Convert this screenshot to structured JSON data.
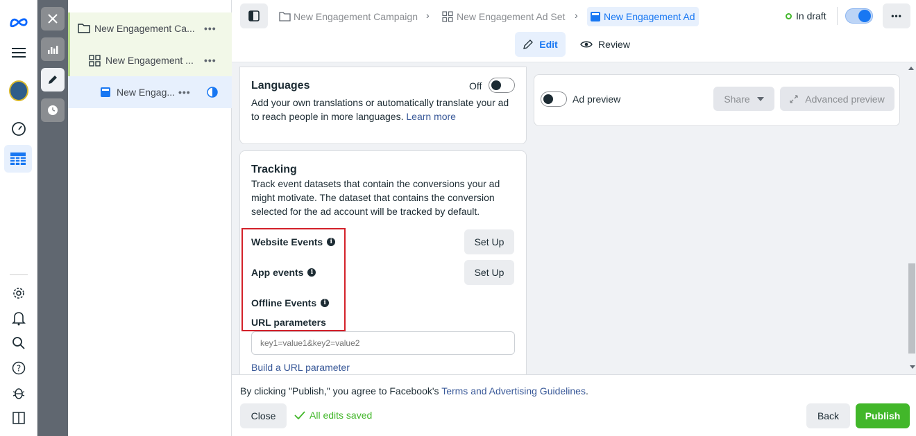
{
  "global_nav": {
    "icons": [
      "meta-logo-icon",
      "menu-icon",
      "account-avatar-icon",
      "dashboard-gauge-icon",
      "ads-manager-table-icon",
      "settings-gear-icon",
      "notifications-bell-icon",
      "search-icon",
      "help-icon",
      "bug-report-icon",
      "panel-toggle-icon"
    ]
  },
  "tree": {
    "campaign": "New Engagement Ca...",
    "ad_set": "New Engagement ...",
    "ad": "New Engag..."
  },
  "header": {
    "breadcrumb_campaign": "New Engagement Campaign",
    "breadcrumb_ad_set": "New Engagement Ad Set",
    "breadcrumb_ad": "New Engagement Ad",
    "status": "In draft",
    "edit_tab": "Edit",
    "review_tab": "Review",
    "accent_color": "#1877f2",
    "status_color": "#42b72a"
  },
  "languages": {
    "title": "Languages",
    "toggle_label": "Off",
    "description": "Add your own translations or automatically translate your ad to reach people in more languages.",
    "learn_more": "Learn more"
  },
  "tracking": {
    "title": "Tracking",
    "description": "Track event datasets that contain the conversions your ad might motivate. The dataset that contains the conversion selected for the ad account will be tracked by default.",
    "website_events": "Website Events",
    "app_events": "App events",
    "offline_events": "Offline Events",
    "setup_label": "Set Up",
    "url_parameters": "URL parameters",
    "url_placeholder": "key1=value1&key2=value2",
    "build_url": "Build a URL parameter"
  },
  "preview": {
    "ad_preview": "Ad preview",
    "share": "Share",
    "advanced_preview": "Advanced preview"
  },
  "footer": {
    "notice_prefix": "By clicking \"Publish,\" you agree to Facebook's",
    "terms_link": "Terms and Advertising Guidelines",
    "notice_suffix": ".",
    "close": "Close",
    "saved": "All edits saved",
    "back": "Back",
    "publish": "Publish",
    "publish_color": "#42b72a"
  }
}
